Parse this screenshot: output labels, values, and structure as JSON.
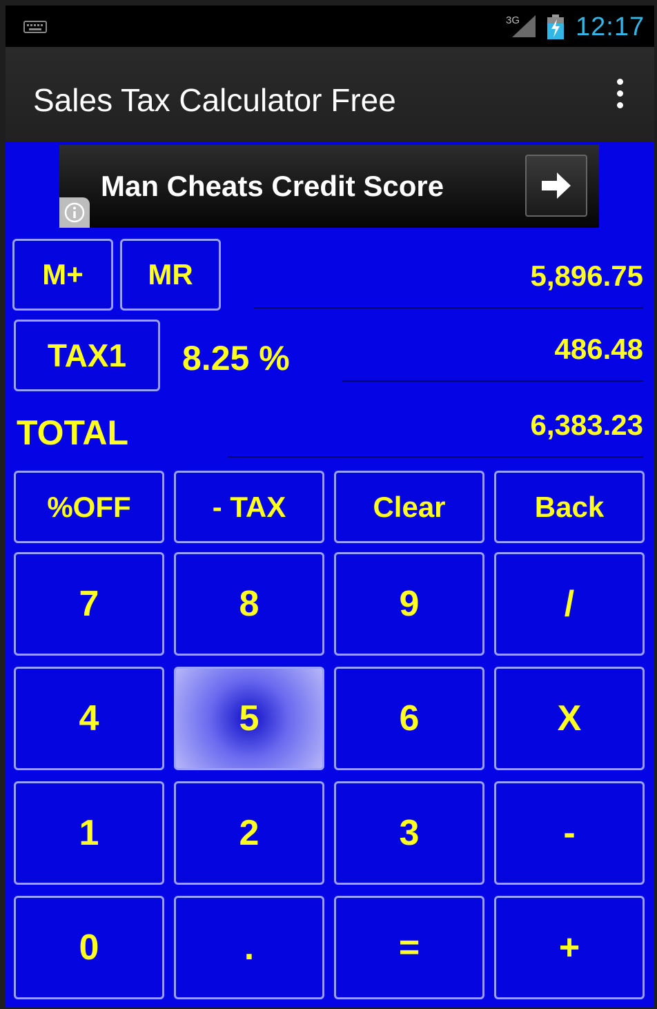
{
  "status_bar": {
    "network": "3G",
    "time": "12:17"
  },
  "action_bar": {
    "title": "Sales Tax Calculator Free"
  },
  "ad": {
    "text": "Man Cheats Credit Score"
  },
  "memory": {
    "mplus_label": "M+",
    "mr_label": "MR"
  },
  "display": {
    "subtotal": "5,896.75",
    "tax_button_label": "TAX1",
    "tax_rate": "8.25 %",
    "tax_amount": "486.48",
    "total_label": "TOTAL",
    "total_value": "6,383.23"
  },
  "keys": {
    "pct_off": "%OFF",
    "minus_tax": "- TAX",
    "clear": "Clear",
    "back": "Back",
    "k7": "7",
    "k8": "8",
    "k9": "9",
    "divide": "/",
    "k4": "4",
    "k5": "5",
    "k6": "6",
    "multiply": "X",
    "k1": "1",
    "k2": "2",
    "k3": "3",
    "minus": "-",
    "k0": "0",
    "dot": ".",
    "equals": "=",
    "plus": "+"
  },
  "colors": {
    "background": "#0404e4",
    "text": "#ffff22",
    "button_border": "#9aa0ff",
    "time": "#33b5e5"
  }
}
